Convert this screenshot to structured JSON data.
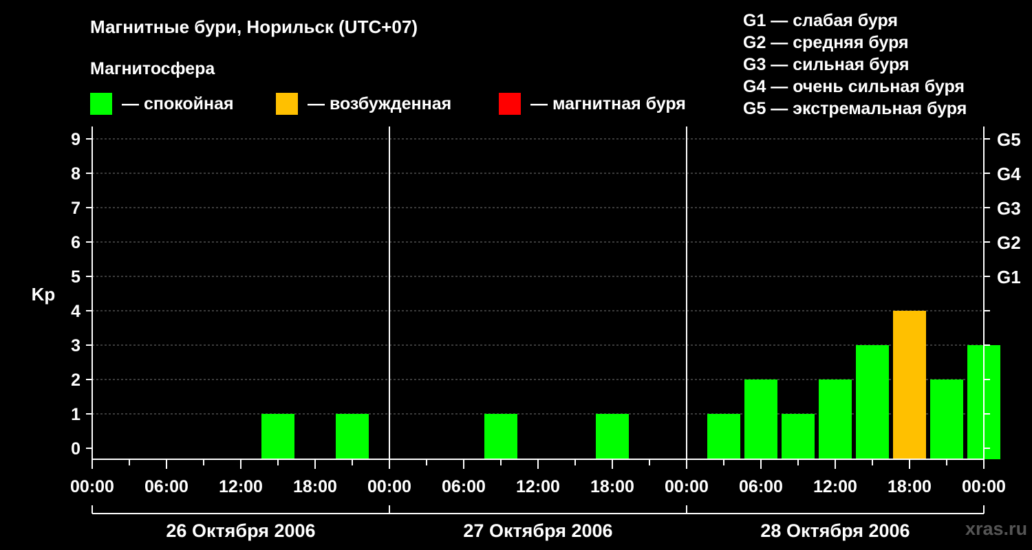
{
  "title": "Магнитные бури, Норильск (UTC+07)",
  "subtitle": "Магнитосфера",
  "legend": [
    {
      "label": "— спокойная",
      "color": "#00ff00"
    },
    {
      "label": "— возбужденная",
      "color": "#ffc000"
    },
    {
      "label": "— магнитная буря",
      "color": "#ff0000"
    }
  ],
  "g_scale": [
    "G1 — слабая буря",
    "G2 — средняя буря",
    "G3 — сильная буря",
    "G4 — очень сильная буря",
    "G5 — экстремальная буря"
  ],
  "watermark": "xras.ru",
  "chart_data": {
    "type": "bar",
    "ylabel": "Kp",
    "ylim": [
      0,
      9
    ],
    "y_ticks": [
      "0",
      "1",
      "2",
      "3",
      "4",
      "5",
      "6",
      "7",
      "8",
      "9"
    ],
    "right_ticks": [
      {
        "kp": 5,
        "label": "G1"
      },
      {
        "kp": 6,
        "label": "G2"
      },
      {
        "kp": 7,
        "label": "G3"
      },
      {
        "kp": 8,
        "label": "G4"
      },
      {
        "kp": 9,
        "label": "G5"
      }
    ],
    "x_tick_labels": [
      "00:00",
      "06:00",
      "12:00",
      "18:00",
      "00:00",
      "06:00",
      "12:00",
      "18:00",
      "00:00",
      "06:00",
      "12:00",
      "18:00",
      "00:00"
    ],
    "days": [
      "26 Октября 2006",
      "27 Октября 2006",
      "28 Октября 2006"
    ],
    "grid": true,
    "levels": {
      "quiet": "#00ff00",
      "active": "#ffc000",
      "storm": "#ff0000"
    },
    "bars": [
      {
        "day": 0,
        "start_hour": 15,
        "kp": 1,
        "level": "quiet"
      },
      {
        "day": 0,
        "start_hour": 21,
        "kp": 1,
        "level": "quiet"
      },
      {
        "day": 1,
        "start_hour": 9,
        "kp": 1,
        "level": "quiet"
      },
      {
        "day": 1,
        "start_hour": 18,
        "kp": 1,
        "level": "quiet"
      },
      {
        "day": 2,
        "start_hour": 3,
        "kp": 1,
        "level": "quiet"
      },
      {
        "day": 2,
        "start_hour": 6,
        "kp": 2,
        "level": "quiet"
      },
      {
        "day": 2,
        "start_hour": 9,
        "kp": 1,
        "level": "quiet"
      },
      {
        "day": 2,
        "start_hour": 12,
        "kp": 2,
        "level": "quiet"
      },
      {
        "day": 2,
        "start_hour": 15,
        "kp": 3,
        "level": "quiet"
      },
      {
        "day": 2,
        "start_hour": 18,
        "kp": 4,
        "level": "active"
      },
      {
        "day": 2,
        "start_hour": 21,
        "kp": 2,
        "level": "quiet"
      },
      {
        "day": 3,
        "start_hour": 0,
        "kp": 3,
        "level": "quiet"
      }
    ]
  }
}
